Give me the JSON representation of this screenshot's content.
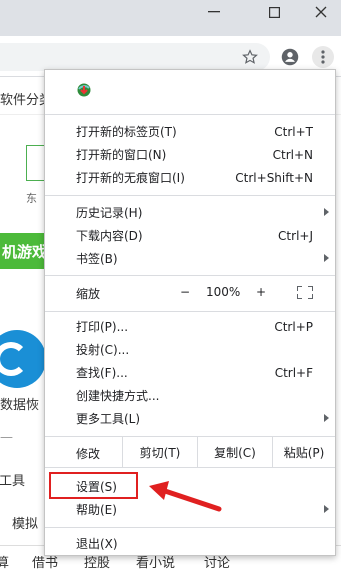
{
  "window": {
    "minimize_icon": "minimize-icon",
    "maximize_icon": "maximize-icon",
    "close_icon": "close-icon"
  },
  "toolbar": {
    "bookmark_icon": "star-icon",
    "profile_icon": "account-icon",
    "menu_icon": "vertical-dots-icon"
  },
  "background_page": {
    "bookmarks_text": "软件分类",
    "text_dong": "东",
    "green_bar_text": "机游戏",
    "data_text": "数据恢",
    "dash_text": "—",
    "tools_text": "具工具",
    "simulate_text": "模拟",
    "bottom_tabs": [
      "算",
      "借书",
      "控股",
      "看小说",
      "讨论"
    ]
  },
  "menu": {
    "app_icon": "download-manager-icon",
    "groups": [
      [
        {
          "label": "打开新的标签页(T)",
          "shortcut": "Ctrl+T"
        },
        {
          "label": "打开新的窗口(N)",
          "shortcut": "Ctrl+N"
        },
        {
          "label": "打开新的无痕窗口(I)",
          "shortcut": "Ctrl+Shift+N"
        }
      ],
      [
        {
          "label": "历史记录(H)",
          "shortcut": ""
        },
        {
          "label": "下载内容(D)",
          "shortcut": "Ctrl+J"
        },
        {
          "label": "书签(B)",
          "shortcut": ""
        }
      ]
    ],
    "zoom": {
      "label": "缩放",
      "minus": "−",
      "value": "100%",
      "plus": "+"
    },
    "tools_group": [
      {
        "label": "打印(P)...",
        "shortcut": "Ctrl+P"
      },
      {
        "label": "投射(C)...",
        "shortcut": ""
      },
      {
        "label": "查找(F)...",
        "shortcut": "Ctrl+F"
      },
      {
        "label": "创建快捷方式...",
        "shortcut": ""
      },
      {
        "label": "更多工具(L)",
        "shortcut": ""
      }
    ],
    "edit": {
      "label": "修改",
      "cut": "剪切(T)",
      "copy": "复制(C)",
      "paste": "粘贴(P)"
    },
    "settings_group": [
      {
        "label": "设置(S)"
      },
      {
        "label": "帮助(E)"
      }
    ],
    "exit": {
      "label": "退出(X)"
    }
  },
  "annotation": {
    "highlight_color": "#e02020"
  }
}
